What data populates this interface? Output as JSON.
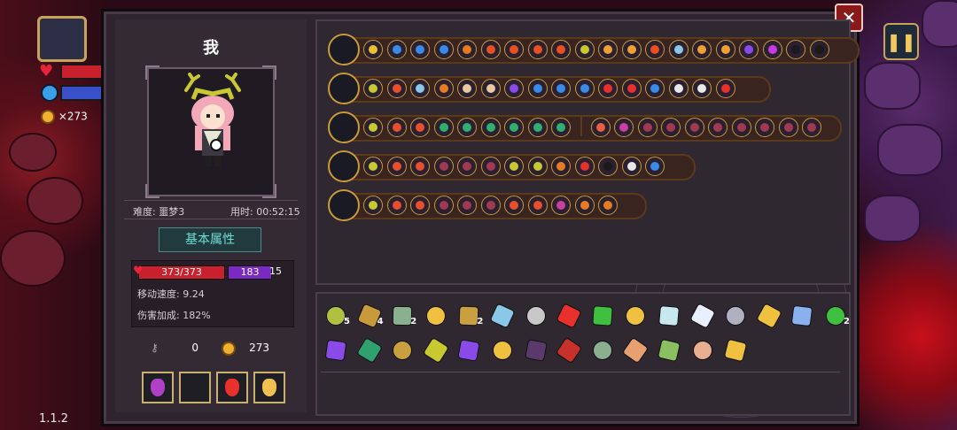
{
  "hud": {
    "coins": "×273",
    "version": "1.1.2",
    "pause_icon": "pause-icon",
    "chest_icon": "chest-icon"
  },
  "window": {
    "close_label": "✕"
  },
  "character": {
    "name": "我",
    "difficulty": "难度: 噩梦3",
    "time": "用时: 00:52:15",
    "basic_attr_button": "基本属性",
    "hp": "373/373",
    "mp": "183",
    "armor": "15",
    "move_speed": "移动速度: 9.24",
    "damage_bonus": "伤害加成: 182%",
    "keys": "0",
    "gold": "273",
    "consumables": [
      {
        "name": "purple-potion-icon",
        "color": "#b040c8"
      },
      {
        "name": "empty-slot",
        "color": "#1e1e24"
      },
      {
        "name": "red-potion-icon",
        "color": "#e8302c"
      },
      {
        "name": "gold-potion-icon",
        "color": "#f0c050"
      }
    ]
  },
  "colors": {
    "gold": "#c89a3a",
    "hp": "#c8202c",
    "mp": "#7a2ac0",
    "accent": "#6ee0d6"
  },
  "weapons": [
    {
      "name": "chest-loadout",
      "icon": "chest-icon",
      "row_len": 590,
      "mods": [
        "#e8c030",
        "#3a8ae8",
        "#3a8ae8",
        "#3a8ae8",
        "#e87a20",
        "#e85020",
        "#e85020",
        "#e85020",
        "#e85020",
        "#c8c830",
        "#f0a030",
        "#f0a030",
        "#e85020",
        "#8ac8e8",
        "#f0a030",
        "#f0a030",
        "#8a4ae8",
        "#c83ae8",
        "#1a1a1a",
        "#1a1a1a"
      ]
    },
    {
      "name": "staff-1",
      "icon": "staff-icon",
      "row_len": 490,
      "mods": [
        "#c8c830",
        "#e8502c",
        "#8ac8e8",
        "#e87a20",
        "#e8c8a0",
        "#e8c8a0",
        "#8a4ae8",
        "#3a8ae8",
        "#3a8ae8",
        "#3a8ae8",
        "#e8302c",
        "#e8302c",
        "#3a8ae8",
        "#e8e8e8",
        "#e8e8e8",
        "#e8302c"
      ]
    },
    {
      "name": "staff-2",
      "icon": "wand-icon",
      "row_len": 570,
      "mods": [
        "#c8c830",
        "#e8502c",
        "#e8502c",
        "#30b070",
        "#30b070",
        "#30b070",
        "#30b070",
        "#30b070",
        "#30b070"
      ],
      "mods2": [
        "#e86040",
        "#c840a0",
        "#a03a50",
        "#a03a50",
        "#a03a50",
        "#a03a50",
        "#a03a50",
        "#a03a50",
        "#a03a50",
        "#a03a50"
      ]
    },
    {
      "name": "sword-1",
      "icon": "sword-icon",
      "row_len": 405,
      "mods": [
        "#c8c830",
        "#e8502c",
        "#e8502c",
        "#a03a50",
        "#a03a50",
        "#a03a50",
        "#c8c830",
        "#c8c830",
        "#e87a20",
        "#e8302c",
        "#1a1a1a",
        "#e8e8e8",
        "#3a8ae8"
      ]
    },
    {
      "name": "staff-3",
      "icon": "green-staff-icon",
      "row_len": 350,
      "mods": [
        "#c8c830",
        "#e8502c",
        "#e8502c",
        "#a03a50",
        "#a03a50",
        "#a03a50",
        "#e8502c",
        "#e8502c",
        "#c840a0",
        "#e87a20",
        "#e87a20"
      ]
    }
  ],
  "inventory": [
    {
      "name": "grass-item",
      "color": "#b0c040",
      "count": "5"
    },
    {
      "name": "pickaxe-item",
      "color": "#c89a3a",
      "count": "4"
    },
    {
      "name": "hammer-item",
      "color": "#8ab090",
      "count": "2"
    },
    {
      "name": "bell-item",
      "color": "#f0c040",
      "count": ""
    },
    {
      "name": "tentacle-item",
      "color": "#c8a040",
      "count": "2"
    },
    {
      "name": "worm-item",
      "color": "#8ac8e8",
      "count": ""
    },
    {
      "name": "dagger-item",
      "color": "#c8c8c8",
      "count": ""
    },
    {
      "name": "coral-item",
      "color": "#e8302c",
      "count": ""
    },
    {
      "name": "slime-item",
      "color": "#40c040",
      "count": ""
    },
    {
      "name": "leaf-item",
      "color": "#f0c040",
      "count": ""
    },
    {
      "name": "crystal-item",
      "color": "#c8e8f0",
      "count": ""
    },
    {
      "name": "lotus-item",
      "color": "#e8f0ff",
      "count": ""
    },
    {
      "name": "scroll-item",
      "color": "#b0b0c0",
      "count": ""
    },
    {
      "name": "rune-item",
      "color": "#f0c040",
      "count": ""
    },
    {
      "name": "gem-item",
      "color": "#8ab0f0",
      "count": ""
    },
    {
      "name": "herb-item",
      "color": "#40c040",
      "count": "2"
    },
    {
      "name": "hat-item",
      "color": "#8a4ae8",
      "count": ""
    },
    {
      "name": "goggles-item",
      "color": "#30a070",
      "count": ""
    },
    {
      "name": "glove-item",
      "color": "#c8a040",
      "count": ""
    },
    {
      "name": "antler-item",
      "color": "#c8c830",
      "count": ""
    },
    {
      "name": "mirror-item",
      "color": "#8a4ae8",
      "count": ""
    },
    {
      "name": "cup-item",
      "color": "#f0c040",
      "count": ""
    },
    {
      "name": "robe-item",
      "color": "#5a3a6a",
      "count": ""
    },
    {
      "name": "staff-item",
      "color": "#c8302c",
      "count": ""
    },
    {
      "name": "arrow-item",
      "color": "#8ab090",
      "count": ""
    },
    {
      "name": "shield-item",
      "color": "#e8a070",
      "count": ""
    },
    {
      "name": "sprout-item",
      "color": "#8ac060",
      "count": ""
    },
    {
      "name": "pet-item",
      "color": "#e8b090",
      "count": ""
    },
    {
      "name": "magnifier-item",
      "color": "#f0c040",
      "count": ""
    }
  ]
}
